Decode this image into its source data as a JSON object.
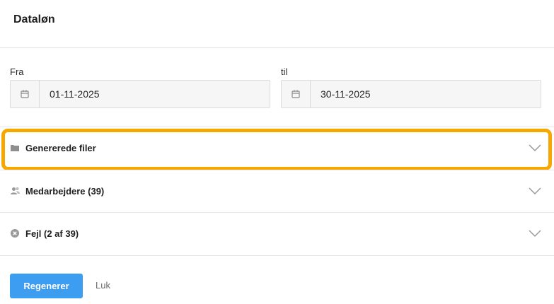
{
  "dialog": {
    "title": "Dataløn"
  },
  "period": {
    "from_label": "Fra",
    "from_value": "01-11-2025",
    "to_label": "til",
    "to_value": "30-11-2025"
  },
  "sections": [
    {
      "label": "Genererede filer",
      "icon": "folder-icon",
      "highlighted": true
    },
    {
      "label": "Medarbejdere (39)",
      "icon": "people-icon"
    },
    {
      "label": "Fejl (2 af 39)",
      "icon": "error-circle-icon"
    }
  ],
  "footer": {
    "primary_label": "Regenerer",
    "secondary_label": "Luk"
  },
  "colors": {
    "accent": "#3d9df0",
    "highlight": "#f6a800"
  }
}
